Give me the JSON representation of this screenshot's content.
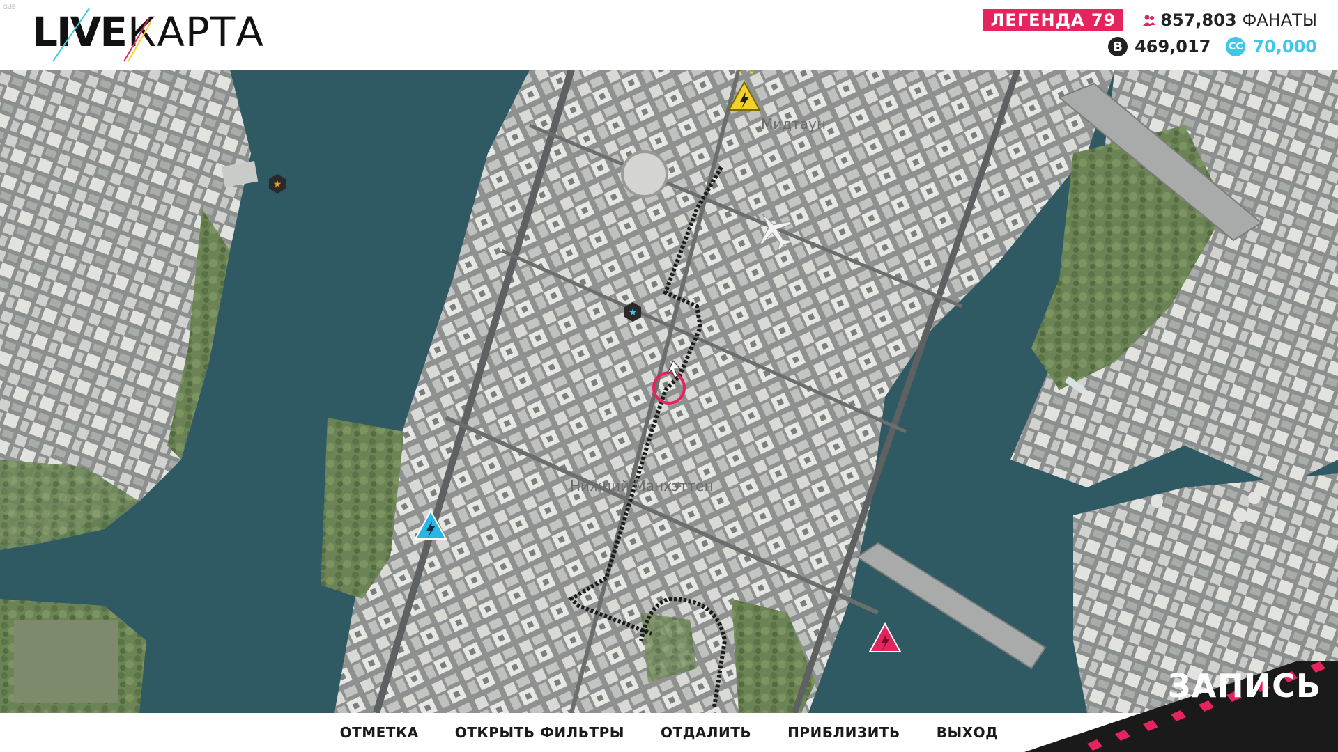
{
  "meta": {
    "corner_label": "GdB"
  },
  "logo": {
    "part1": "LIVE",
    "part2": "КАРТА"
  },
  "stats": {
    "legend_label": "ЛЕГЕНДА 79",
    "fans_count": "857,803",
    "fans_label": "ФАНАТЫ",
    "bucks": "469,017",
    "cc": "70,000",
    "cc_icon_text": "CC",
    "bucks_icon_text": "B"
  },
  "map": {
    "districts": [
      {
        "label": "Мидтаун"
      },
      {
        "label": "Нижний Манхэттен"
      }
    ]
  },
  "nav": {
    "items": [
      "ОТМЕТКА",
      "ОТКРЫТЬ ФИЛЬТРЫ",
      "ОТДАЛИТЬ",
      "ПРИБЛИЗИТЬ",
      "ВЫХОД"
    ]
  },
  "record": {
    "label": "ЗАПИСЬ"
  },
  "colors": {
    "accent_pink": "#e5245d",
    "accent_cyan": "#3cc8e6",
    "water": "#2d5560",
    "event_yellow": "#f3d12a"
  }
}
